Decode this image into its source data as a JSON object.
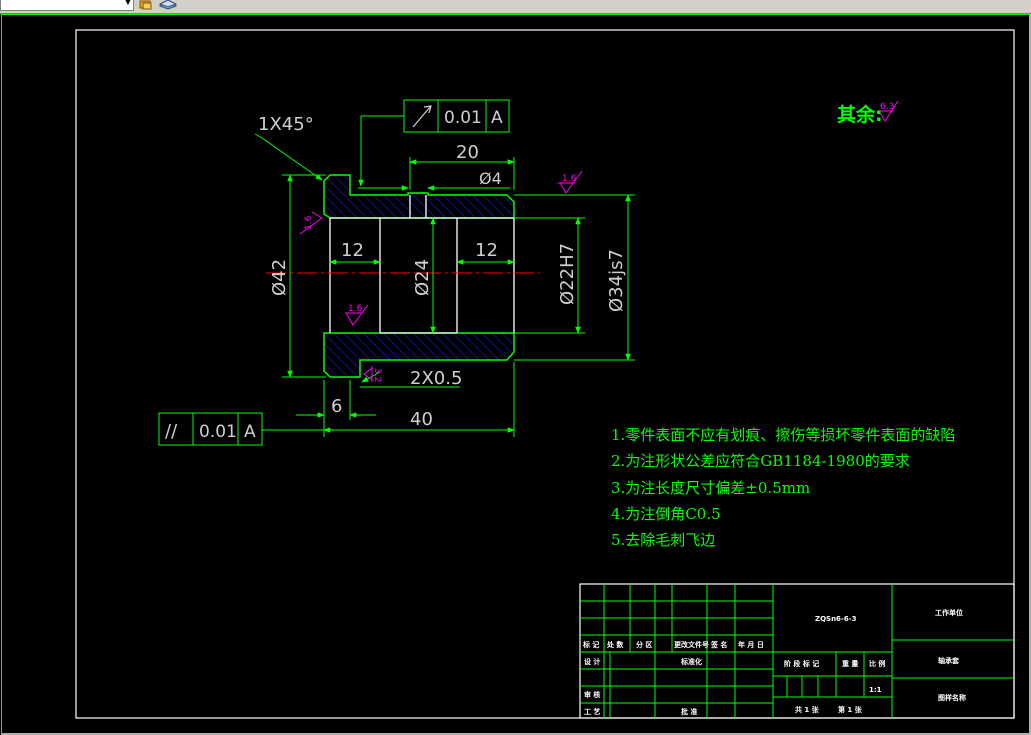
{
  "toolbar": {
    "icon_1": "layer-icon",
    "icon_2": "layers-stack-icon"
  },
  "colors": {
    "background": "#000000",
    "frame": "#ffffff",
    "part_outline": "#00ff00",
    "dimension": "#00ff00",
    "hatch": "#1a1ae6",
    "centerline": "#ff0000",
    "roughness": "#ff00ff",
    "dim_text": "#cfcfcf"
  },
  "drawing": {
    "chamfer_label": "1X45°",
    "tolerance_top": {
      "symbol": "↗",
      "value": "0.01",
      "datum": "A"
    },
    "tolerance_left": {
      "symbol": "//",
      "value": "0.01",
      "datum": "A"
    },
    "dims": {
      "len_20": "20",
      "dia_4": "Ø4",
      "len_12_left": "12",
      "len_12_right": "12",
      "dia_42": "Ø42",
      "dia_24": "Ø24",
      "dia_22h7": "Ø22H7",
      "dia_34js7": "Ø34js7",
      "groove": "2X0.5",
      "len_6": "6",
      "len_40": "40"
    },
    "roughness": {
      "top": "1.6",
      "left": "1.6",
      "bore": "1.6",
      "bottom": "3.2",
      "rest_label": "其余:",
      "rest_value": "6.3"
    }
  },
  "notes": [
    "1.零件表面不应有划痕、擦伤等损坏零件表面的缺陷",
    "2.为注形状公差应符合GB1184-1980的要求",
    "3.为注长度尺寸偏差±0.5mm",
    "4.为注倒角C0.5",
    "5.去除毛刺飞边"
  ],
  "title_block": {
    "material": "ZQSn6-6-3",
    "company": "工作单位",
    "part_name": "轴承套",
    "drawing_no": "图样名称",
    "scale": "1:1",
    "sheet_total": "共 1 张",
    "sheet_no": "第 1 张",
    "row_labels": [
      "标 记",
      "处 数",
      "分 区",
      "更改文件号",
      "签 名",
      "年 月 日"
    ],
    "designer": "设 计",
    "standardize": "标准化",
    "review": "审 核",
    "process": "工 艺",
    "approve": "批 准",
    "stage_label": "阶 段 标 记",
    "weight_label": "重 量",
    "ratio_label": "比 例"
  }
}
